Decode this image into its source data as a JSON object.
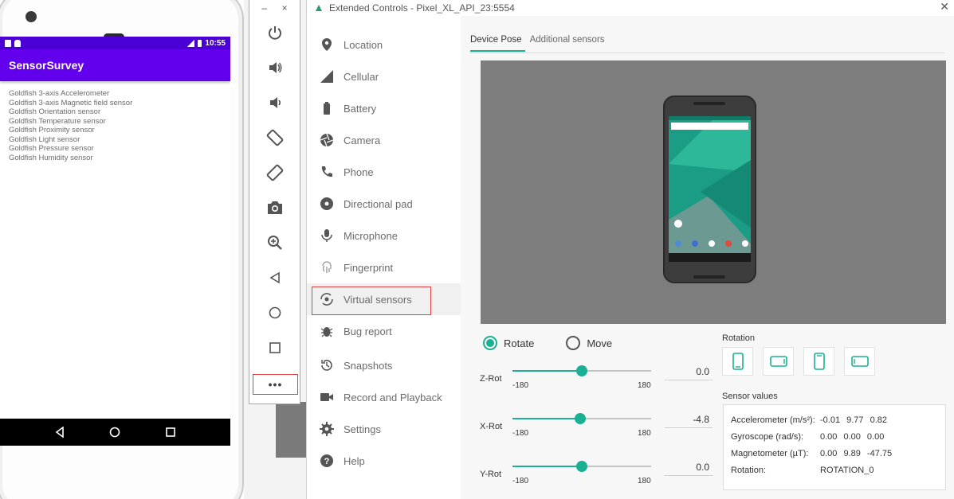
{
  "emulator": {
    "status_time": "10:55",
    "app_title": "SensorSurvey",
    "sensors": [
      "Goldfish 3-axis Accelerometer",
      "Goldfish 3-axis Magnetic field sensor",
      "Goldfish Orientation sensor",
      "Goldfish Temperature sensor",
      "Goldfish Proximity sensor",
      "Goldfish Light sensor",
      "Goldfish Pressure sensor",
      "Goldfish Humidity sensor"
    ],
    "toolbar": {
      "minimize": "–",
      "close": "×",
      "more": "•••"
    }
  },
  "extended_controls": {
    "window_title": "Extended Controls - Pixel_XL_API_23:5554",
    "close": "✕",
    "nav": [
      {
        "label": "Location",
        "icon": "location-pin-icon"
      },
      {
        "label": "Cellular",
        "icon": "cellular-signal-icon"
      },
      {
        "label": "Battery",
        "icon": "battery-icon"
      },
      {
        "label": "Camera",
        "icon": "camera-aperture-icon"
      },
      {
        "label": "Phone",
        "icon": "phone-icon"
      },
      {
        "label": "Directional pad",
        "icon": "dpad-icon"
      },
      {
        "label": "Microphone",
        "icon": "microphone-icon"
      },
      {
        "label": "Fingerprint",
        "icon": "fingerprint-icon"
      },
      {
        "label": "Virtual sensors",
        "icon": "virtual-sensors-icon"
      },
      {
        "label": "Bug report",
        "icon": "bug-icon"
      },
      {
        "label": "Snapshots",
        "icon": "history-icon"
      },
      {
        "label": "Record and Playback",
        "icon": "video-camera-icon"
      },
      {
        "label": "Settings",
        "icon": "gear-icon"
      },
      {
        "label": "Help",
        "icon": "help-icon"
      }
    ],
    "active_nav": "Virtual sensors",
    "tabs": [
      "Device Pose",
      "Additional sensors"
    ],
    "active_tab": "Device Pose",
    "mode": {
      "rotate_label": "Rotate",
      "move_label": "Move",
      "selected": "Rotate"
    },
    "sliders": [
      {
        "label": "Z-Rot",
        "min": "-180",
        "max": "180",
        "value": "0.0",
        "fraction": 0.5
      },
      {
        "label": "X-Rot",
        "min": "-180",
        "max": "180",
        "value": "-4.8",
        "fraction": 0.487
      },
      {
        "label": "Y-Rot",
        "min": "-180",
        "max": "180",
        "value": "0.0",
        "fraction": 0.5
      }
    ],
    "rotation_title": "Rotation",
    "sensor_values_title": "Sensor values",
    "sensor_values": [
      {
        "label": "Accelerometer (m/s²):",
        "value": "-0.01 9.77 0.82"
      },
      {
        "label": "Gyroscope (rad/s):",
        "value": "0.00 0.00 0.00"
      },
      {
        "label": "Magnetometer (µT):",
        "value": "0.00 9.89 -47.75"
      },
      {
        "label": "Rotation:",
        "value": "ROTATION_0"
      }
    ],
    "accent_color": "#1ab093"
  }
}
